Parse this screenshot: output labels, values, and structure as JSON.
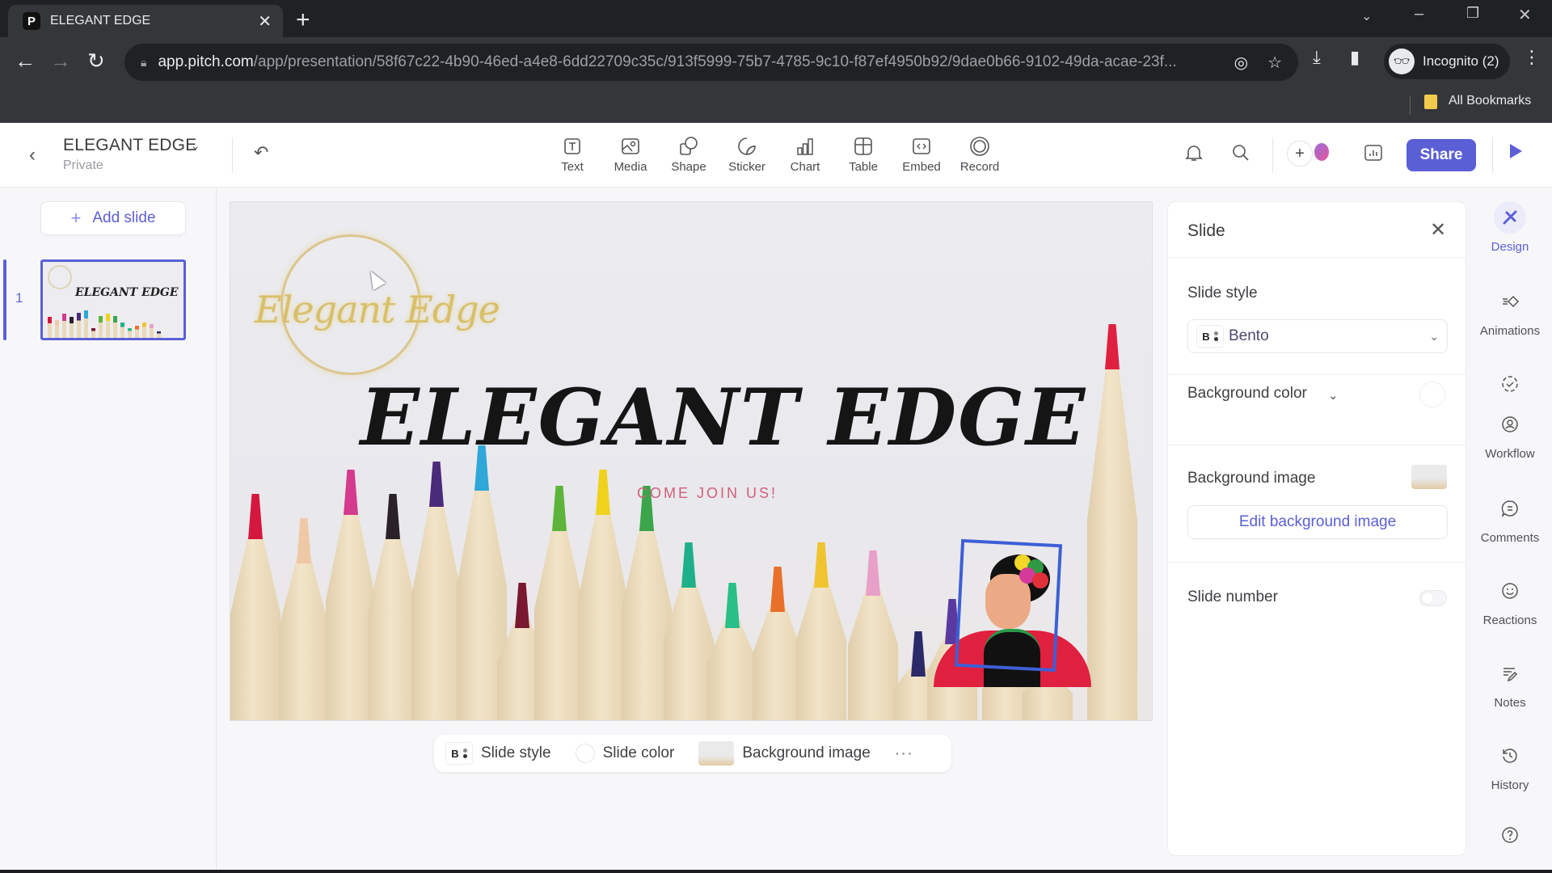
{
  "browser": {
    "tab_title": "ELEGANT EDGE",
    "favicon": "P",
    "url_host": "app.pitch.com",
    "url_path": "/app/presentation/58f67c22-4b90-46ed-a4e8-6dd22709c35c/913f5999-75b7-4785-9c10-f87ef4950b92/9dae0b66-9102-49da-acae-23f...",
    "profile_label": "Incognito (2)",
    "bookmarks_label": "All Bookmarks"
  },
  "header": {
    "doc_title": "ELEGANT EDGE",
    "doc_visibility": "Private",
    "tools": [
      {
        "label": "Text",
        "icon": "text-icon"
      },
      {
        "label": "Media",
        "icon": "media-icon"
      },
      {
        "label": "Shape",
        "icon": "shape-icon"
      },
      {
        "label": "Sticker",
        "icon": "sticker-icon"
      },
      {
        "label": "Chart",
        "icon": "chart-icon"
      },
      {
        "label": "Table",
        "icon": "table-icon"
      },
      {
        "label": "Embed",
        "icon": "embed-icon"
      },
      {
        "label": "Record",
        "icon": "record-icon"
      }
    ],
    "share_label": "Share"
  },
  "left_panel": {
    "add_slide_label": "Add slide",
    "slides": [
      {
        "number": "1",
        "title": "ELEGANT EDGE"
      }
    ]
  },
  "slide": {
    "logo_text": "Elegant Edge",
    "title": "ELEGANT EDGE",
    "subtitle": "COME JOIN US!",
    "pencil_colors": [
      "#d4173f",
      "#efc8a6",
      "#d43a8e",
      "#2a2228",
      "#4a2a7a",
      "#2fa7d8",
      "#7a1830",
      "#5cb53a",
      "#f0d21c",
      "#3aa54a",
      "#1fb08a",
      "#2bbf88",
      "#e8702a",
      "#f0c430",
      "#e8a0c8",
      "#2a2a6a",
      "#5a3aa0",
      "#c040b0",
      "#e8602a",
      "#e02040"
    ],
    "subtitle_color": "#d0607a"
  },
  "bottom_bar": {
    "style_badge": "B",
    "slide_style_label": "Slide style",
    "slide_color_label": "Slide color",
    "background_image_label": "Background image",
    "more_label": "···"
  },
  "design_panel": {
    "title": "Slide",
    "slide_style_heading": "Slide style",
    "slide_style_badge": "B",
    "slide_style_value": "Bento",
    "background_color_label": "Background color",
    "background_image_label": "Background image",
    "edit_background_label": "Edit background image",
    "slide_number_label": "Slide number",
    "slide_number_enabled": false
  },
  "rail": {
    "items": [
      {
        "label": "Design",
        "icon": "design-icon",
        "active": true
      },
      {
        "label": "Animations",
        "icon": "animations-icon",
        "active": false
      },
      {
        "label": "Workflow",
        "icon": "workflow-icon",
        "active": false
      },
      {
        "label": "Comments",
        "icon": "comments-icon",
        "active": false
      },
      {
        "label": "Reactions",
        "icon": "reactions-icon",
        "active": false
      },
      {
        "label": "Notes",
        "icon": "notes-icon",
        "active": false
      },
      {
        "label": "History",
        "icon": "history-icon",
        "active": false
      }
    ]
  },
  "colors": {
    "accent": "#5b5fd6",
    "chrome_dark": "#202124",
    "chrome_mid": "#35363a"
  }
}
